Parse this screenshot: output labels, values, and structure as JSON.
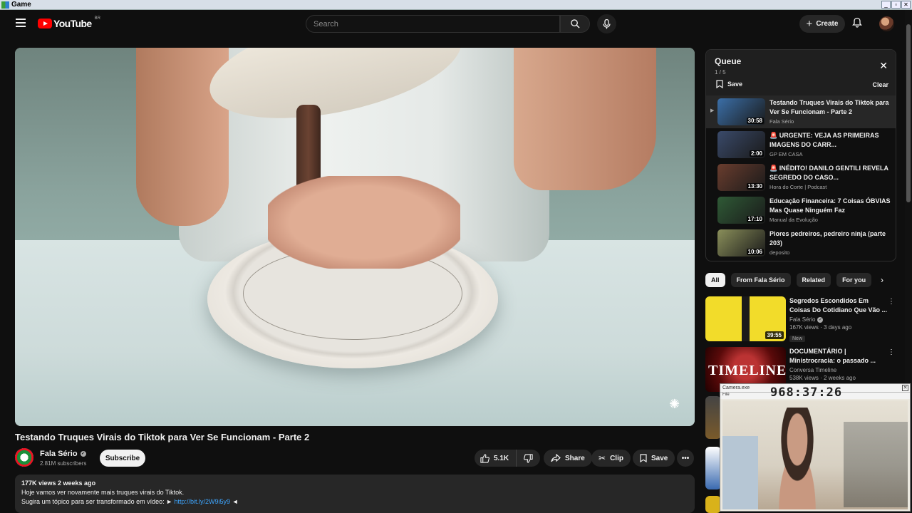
{
  "window": {
    "title": "Game",
    "controls": [
      "_",
      "▫",
      "✕"
    ]
  },
  "header": {
    "logo_text": "YouTube",
    "country_code": "BR",
    "search_placeholder": "Search",
    "create_label": "Create"
  },
  "video": {
    "title": "Testando Truques Virais do Tiktok para Ver Se Funcionam - Parte 2",
    "channel": "Fala Sério",
    "subscribers": "2.81M subscribers",
    "subscribe_label": "Subscribe",
    "likes": "5.1K",
    "share_label": "Share",
    "clip_label": "Clip",
    "save_label": "Save",
    "description": {
      "meta": "177K views  2 weeks ago",
      "line1": "Hoje vamos ver novamente mais truques virais do Tiktok.",
      "line2_prefix": "Sugira um tópico para ser transformado em vídeo: ► ",
      "link": "http://bit.ly/2W9i5y9",
      "line2_suffix": " ◄"
    }
  },
  "queue": {
    "title": "Queue",
    "count": "1 / 5",
    "save_label": "Save",
    "clear_label": "Clear",
    "items": [
      {
        "title": "Testando Truques Virais do Tiktok para Ver Se Funcionam - Parte 2",
        "channel": "Fala Sério",
        "duration": "30:58",
        "active": true,
        "thumb_color": "#3b6fa8"
      },
      {
        "title": "🚨 URGENTE: VEJA AS PRIMEIRAS IMAGENS DO CARR...",
        "channel": "GP EM CASA",
        "duration": "2:00",
        "active": false,
        "thumb_color": "#3a4a6a"
      },
      {
        "title": "🚨 INÉDITO! DANILO GENTILI REVELA SEGREDO DO CASO...",
        "channel": "Hora do Corte | Podcast",
        "duration": "13:30",
        "active": false,
        "thumb_color": "#6a3d2e"
      },
      {
        "title": "Educação Financeira: 7 Coisas ÓBVIAS Mas Quase Ninguém Faz",
        "channel": "Manual da Evolução",
        "duration": "17:10",
        "active": false,
        "thumb_color": "#2f5a36"
      },
      {
        "title": "Piores pedreiros, pedreiro ninja (parte 203)",
        "channel": "deposito",
        "duration": "10:06",
        "active": false,
        "thumb_color": "#8a8f5a"
      }
    ]
  },
  "chips": [
    "All",
    "From Fala Sério",
    "Related",
    "For you"
  ],
  "recommendations": [
    {
      "title": "Segredos Escondidos Em Coisas Do Cotidiano Que Vão ...",
      "channel": "Fala Sério",
      "verified": true,
      "stats": "167K views · 3 days ago",
      "badge": "New",
      "duration": "39:55",
      "thumb_color": "#e8d21a"
    },
    {
      "title": "DOCUMENTÁRIO | Ministrocracia: o passado ...",
      "channel": "Conversa Timeline",
      "verified": false,
      "stats": "538K views · 2 weeks ago",
      "badge": "",
      "duration": "",
      "thumb_color": "#7a1010"
    }
  ],
  "camera_overlay": {
    "title": "Camera.exe",
    "menu": "File",
    "timer": "968:37:26"
  }
}
